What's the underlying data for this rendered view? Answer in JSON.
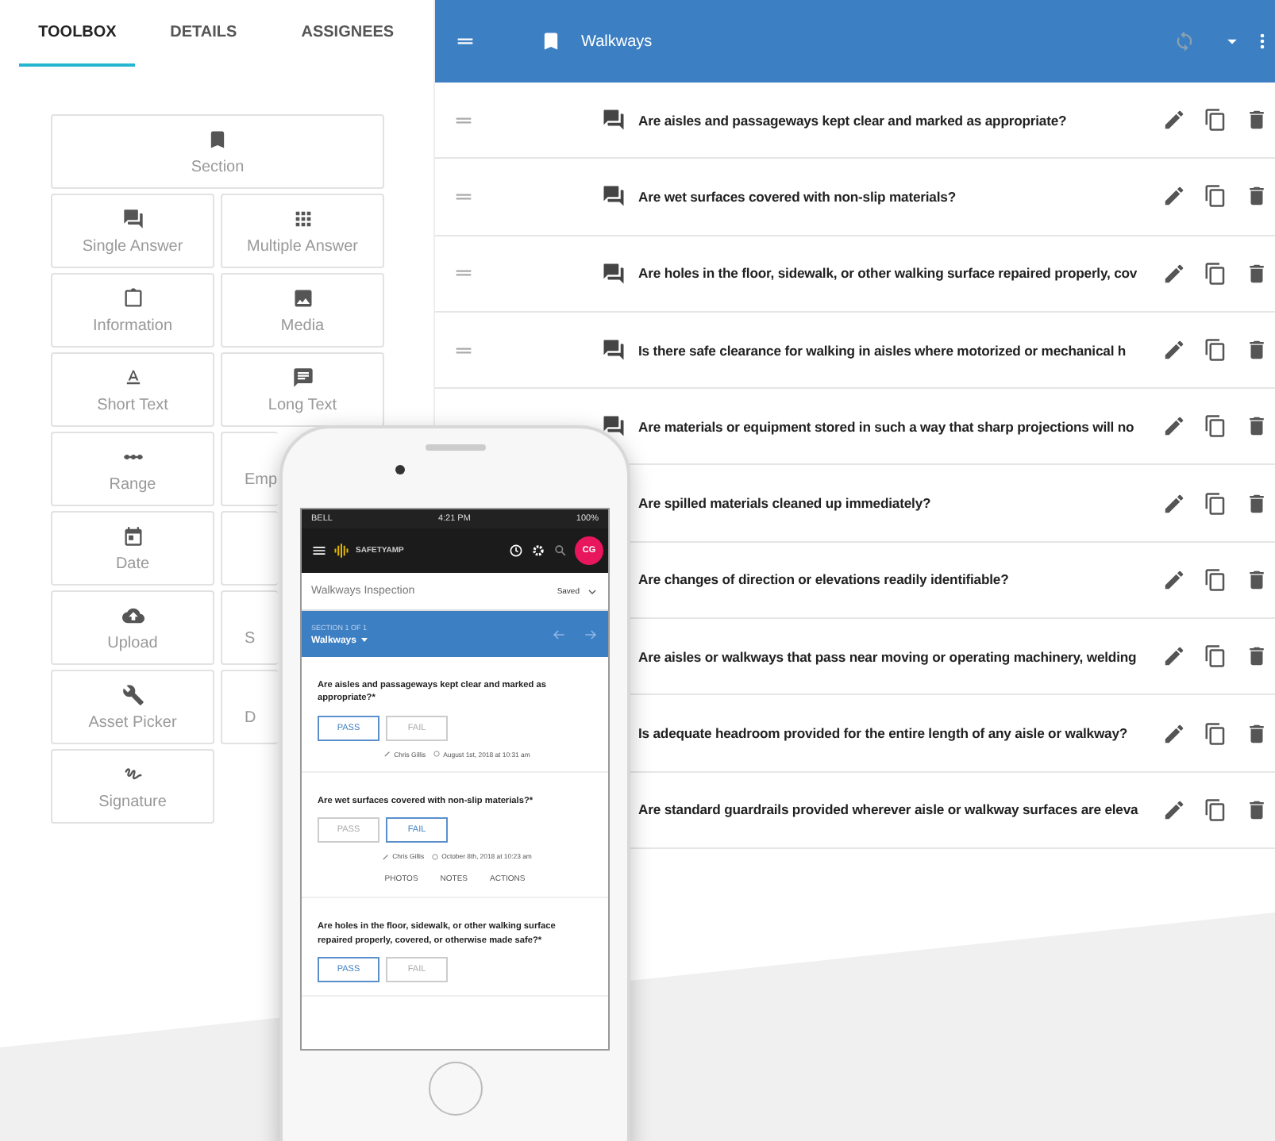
{
  "tabs": [
    {
      "label": "TOOLBOX",
      "selected": true
    },
    {
      "label": "DETAILS",
      "selected": false
    },
    {
      "label": "ASSIGNEES",
      "selected": false
    }
  ],
  "toolbox": [
    {
      "kind": "section",
      "label": "Section"
    },
    {
      "kind": "single-answer",
      "label": "Single Answer"
    },
    {
      "kind": "multiple-answer",
      "label": "Multiple Answer"
    },
    {
      "kind": "information",
      "label": "Information"
    },
    {
      "kind": "media",
      "label": "Media"
    },
    {
      "kind": "short-text",
      "label": "Short Text"
    },
    {
      "kind": "long-text",
      "label": "Long Text"
    },
    {
      "kind": "range",
      "label": "Range"
    },
    {
      "kind": "partial",
      "label": "Emp"
    },
    {
      "kind": "date",
      "label": "Date"
    },
    {
      "kind": "partial"
    },
    {
      "kind": "upload",
      "label": "Upload"
    },
    {
      "kind": "partial",
      "label": "S"
    },
    {
      "kind": "asset-picker",
      "label": "Asset Picker"
    },
    {
      "kind": "partial",
      "label": "D"
    },
    {
      "kind": "signature",
      "label": "Signature"
    }
  ],
  "section_header": {
    "title": "Walkways"
  },
  "questions": [
    {
      "text": "Are aisles and passageways kept clear and marked as appropriate?",
      "handle": true
    },
    {
      "text": "Are wet surfaces covered with non-slip materials?",
      "handle": true
    },
    {
      "text": "Are holes in the floor, sidewalk, or other walking surface repaired properly, cov",
      "handle": true
    },
    {
      "text": "Is there safe clearance for walking in aisles where motorized or mechanical h",
      "handle": true
    },
    {
      "text": "Are materials or equipment stored in such a way that sharp projections will no",
      "handle": false
    },
    {
      "text": "Are spilled materials cleaned up immediately?",
      "handle": false
    },
    {
      "text": "Are changes of direction or elevations readily identifiable?",
      "handle": false
    },
    {
      "text": "Are aisles or walkways that pass near moving or operating machinery, welding",
      "handle": false
    },
    {
      "text": "Is adequate headroom provided for the entire length of any aisle or walkway?",
      "handle": false
    },
    {
      "text": "Are standard guardrails provided wherever aisle or walkway surfaces are eleva",
      "handle": false
    }
  ],
  "phone": {
    "carrier": "BELL",
    "time": "4:21 PM",
    "battery": "100%",
    "brand": "SAFETYAMP",
    "avatar": "CG",
    "form_title": "Walkways Inspection",
    "save_status": "Saved",
    "section_label": "SECTION 1 OF 1",
    "section_name": "Walkways",
    "questions": [
      {
        "text": "Are aisles and passageways kept clear and marked as appropriate?*",
        "answers": [
          {
            "label": "PASS",
            "selected": true
          },
          {
            "label": "FAIL",
            "selected": false
          }
        ],
        "author": "Chris Gillis",
        "timestamp": "August 1st, 2018 at 10:31 am"
      },
      {
        "text": "Are wet surfaces covered with non-slip materials?*",
        "answers": [
          {
            "label": "PASS",
            "selected": false
          },
          {
            "label": "FAIL",
            "selected": true
          }
        ],
        "author": "Chris Gillis",
        "timestamp": "October 8th, 2018 at 10:23 am",
        "actions": [
          "PHOTOS",
          "NOTES",
          "ACTIONS"
        ]
      },
      {
        "text": "Are holes in the floor, sidewalk, or other walking surface repaired properly, covered, or otherwise made safe?*",
        "answers": [
          {
            "label": "PASS",
            "selected": true
          },
          {
            "label": "FAIL",
            "selected": false
          }
        ]
      }
    ]
  }
}
